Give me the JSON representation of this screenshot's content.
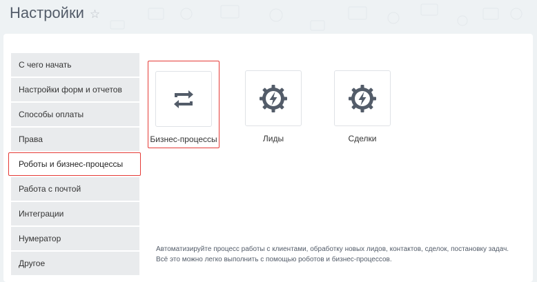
{
  "header": {
    "title": "Настройки",
    "favorite_icon": "star-outline-icon"
  },
  "sidebar": {
    "items": [
      {
        "label": "С чего начать",
        "active": false
      },
      {
        "label": "Настройки форм и отчетов",
        "active": false
      },
      {
        "label": "Способы оплаты",
        "active": false
      },
      {
        "label": "Права",
        "active": false
      },
      {
        "label": "Роботы и бизнес-процессы",
        "active": true
      },
      {
        "label": "Работа с почтой",
        "active": false
      },
      {
        "label": "Интеграции",
        "active": false
      },
      {
        "label": "Нумератор",
        "active": false
      },
      {
        "label": "Другое",
        "active": false
      }
    ]
  },
  "main": {
    "tiles": [
      {
        "label": "Бизнес-процессы",
        "icon": "business-process-icon",
        "selected": true
      },
      {
        "label": "Лиды",
        "icon": "robot-gear-icon",
        "selected": false
      },
      {
        "label": "Сделки",
        "icon": "robot-gear-icon",
        "selected": false
      }
    ],
    "description": "Автоматизируйте процесс работы с клиентами, обработку новых лидов, контактов, сделок, постановку задач. Всё это можно легко выполнить с помощью роботов и бизнес-процессов."
  },
  "colors": {
    "accent_border": "#e53935",
    "icon": "#535c69",
    "menu_bg": "#e9ebed",
    "page_bg": "#eef2f4"
  }
}
